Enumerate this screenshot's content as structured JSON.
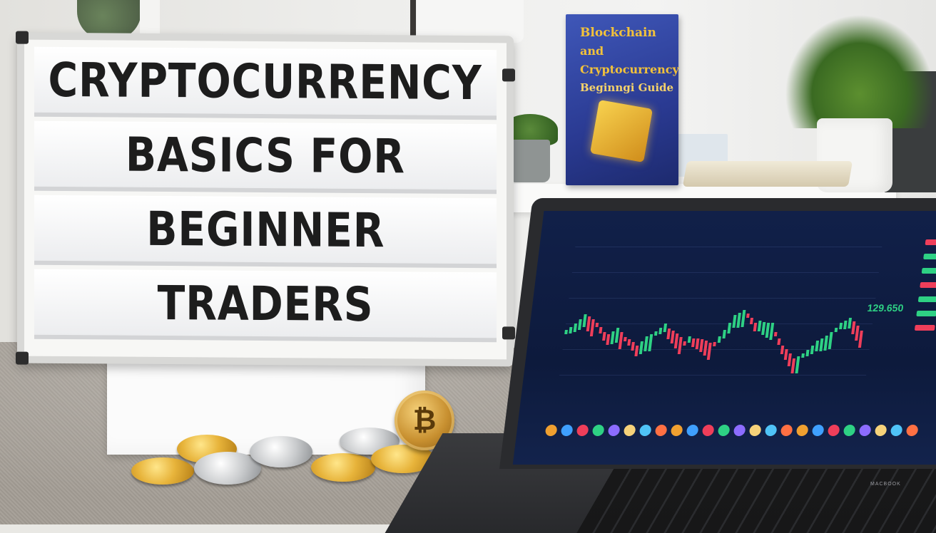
{
  "sign": {
    "lines": [
      "CRYPTOCURRENCY",
      "BASICS FOR",
      "BEGINNER",
      "TRADERS"
    ]
  },
  "book": {
    "title_line1": "Blockchain",
    "title_line2": "and",
    "title_line3": "Cryptocurrency",
    "title_line4": "Beginngi Guide"
  },
  "laptop": {
    "price": "129.650",
    "brand": "MACBOOK"
  },
  "coin": {
    "symbol": "₿"
  },
  "colors": {
    "candle_up": "#2ed184",
    "candle_down": "#ef3e5a",
    "screen_bg": "#112049",
    "book_cover": "#2a3a92"
  }
}
